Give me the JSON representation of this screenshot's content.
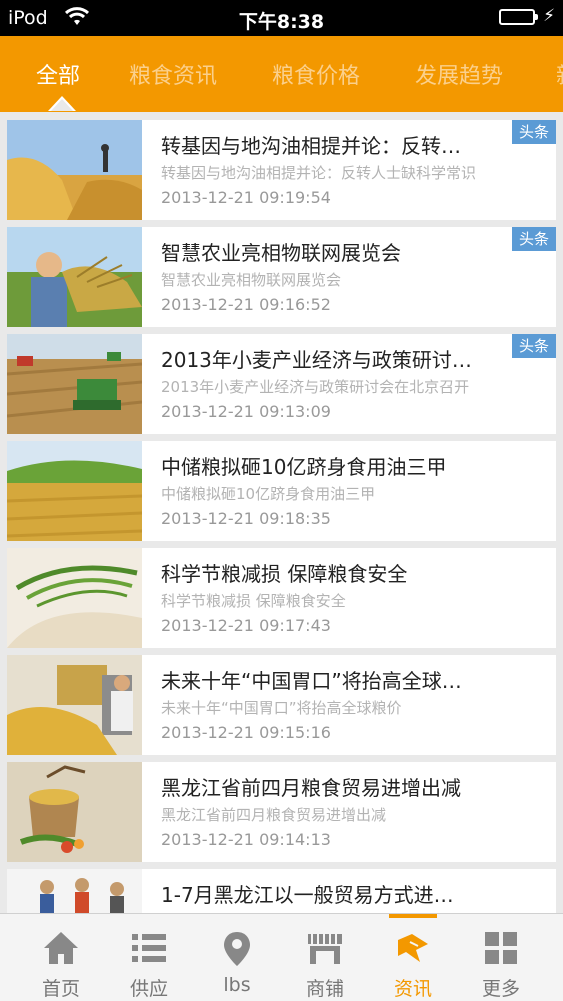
{
  "status_bar": {
    "carrier": "iPod",
    "time": "下午8:38"
  },
  "tabs": [
    {
      "label": "全部",
      "active": true
    },
    {
      "label": "粮食资讯",
      "active": false
    },
    {
      "label": "粮食价格",
      "active": false
    },
    {
      "label": "发展趋势",
      "active": false
    },
    {
      "label": "新",
      "active": false
    }
  ],
  "articles": [
    {
      "title": "转基因与地沟油相提并论：反转…",
      "summary": "转基因与地沟油相提并论：反转人士缺科学常识",
      "time": "2013-12-21 09:19:54",
      "badge": "头条"
    },
    {
      "title": "智慧农业亮相物联网展览会",
      "summary": "智慧农业亮相物联网展览会",
      "time": "2013-12-21 09:16:52",
      "badge": "头条"
    },
    {
      "title": "2013年小麦产业经济与政策研讨…",
      "summary": "2013年小麦产业经济与政策研讨会在北京召开",
      "time": "2013-12-21 09:13:09",
      "badge": "头条"
    },
    {
      "title": "中储粮拟砸10亿跻身食用油三甲",
      "summary": "中储粮拟砸10亿跻身食用油三甲",
      "time": "2013-12-21 09:18:35",
      "badge": ""
    },
    {
      "title": "科学节粮减损 保障粮食安全",
      "summary": "科学节粮减损 保障粮食安全",
      "time": "2013-12-21 09:17:43",
      "badge": ""
    },
    {
      "title": "未来十年“中国胃口”将抬高全球…",
      "summary": "未来十年“中国胃口”将抬高全球粮价",
      "time": "2013-12-21 09:15:16",
      "badge": ""
    },
    {
      "title": "黑龙江省前四月粮食贸易进增出减",
      "summary": "黑龙江省前四月粮食贸易进增出减",
      "time": "2013-12-21 09:14:13",
      "badge": ""
    },
    {
      "title": "1-7月黑龙江以一般贸易方式进…",
      "summary": "",
      "time": "",
      "badge": ""
    }
  ],
  "bottom_nav": [
    {
      "label": "首页",
      "icon": "home-icon"
    },
    {
      "label": "供应",
      "icon": "list-icon"
    },
    {
      "label": "lbs",
      "icon": "location-pin-icon"
    },
    {
      "label": "商铺",
      "icon": "shop-icon"
    },
    {
      "label": "资讯",
      "icon": "news-icon",
      "active": true
    },
    {
      "label": "更多",
      "icon": "grid-icon"
    }
  ],
  "colors": {
    "accent": "#f39800",
    "badge": "#5b9bd5"
  }
}
